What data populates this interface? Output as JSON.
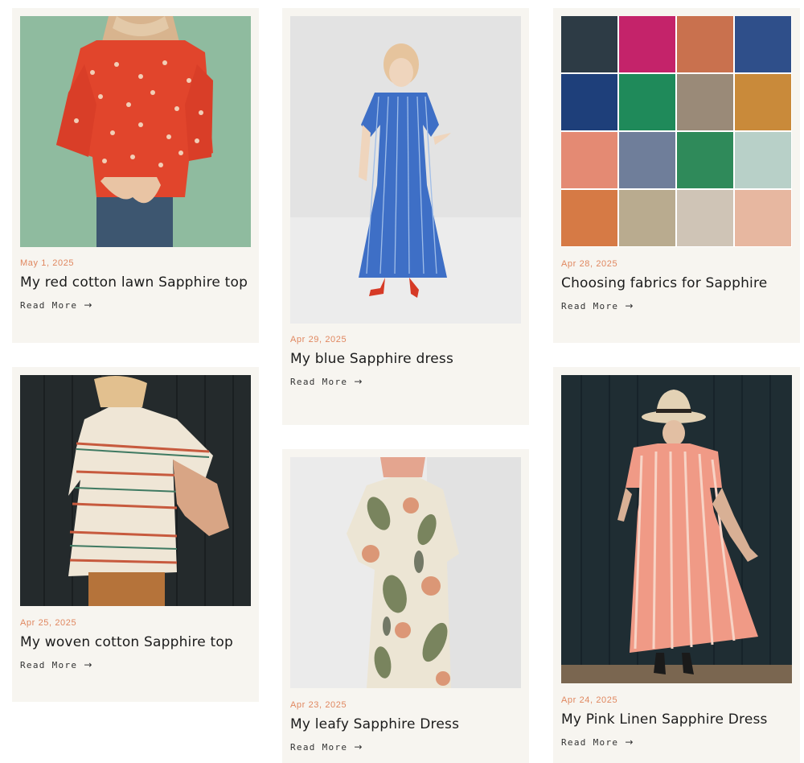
{
  "posts": [
    {
      "date": "May 1, 2025",
      "title": "My red cotton lawn Sapphire top",
      "read_more": "Read More",
      "arrow": "→"
    },
    {
      "date": "Apr 29, 2025",
      "title": "My blue Sapphire dress",
      "read_more": "Read More",
      "arrow": "→"
    },
    {
      "date": "Apr 28, 2025",
      "title": "Choosing fabrics for Sapphire",
      "read_more": "Read More",
      "arrow": "→"
    },
    {
      "date": "Apr 25, 2025",
      "title": "My woven cotton Sapphire top",
      "read_more": "Read More",
      "arrow": "→"
    },
    {
      "date": "Apr 23, 2025",
      "title": "My leafy Sapphire Dress",
      "read_more": "Read More",
      "arrow": "→"
    },
    {
      "date": "Apr 24, 2025",
      "title": "My Pink Linen Sapphire Dress",
      "read_more": "Read More",
      "arrow": "→"
    }
  ],
  "colors": {
    "card_background": "#f7f5f0",
    "date": "#e0875f",
    "title": "#1b1b1b"
  }
}
